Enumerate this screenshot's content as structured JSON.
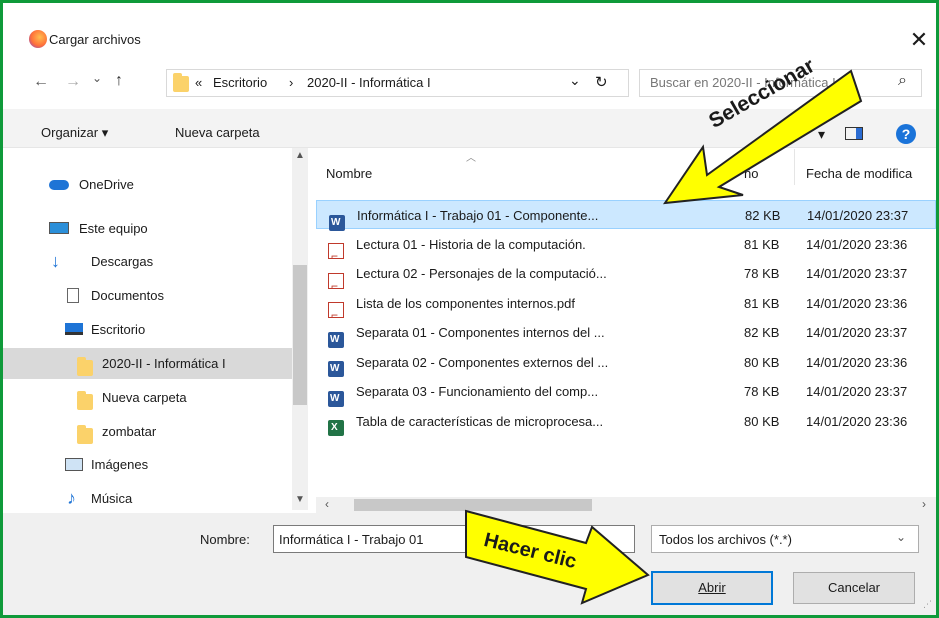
{
  "window": {
    "title": "Cargar archivos",
    "close": "✕"
  },
  "nav": {
    "back": "←",
    "forward": "→",
    "recent": "⌄",
    "up": "↑"
  },
  "address": {
    "overflow": "«",
    "crumb1": "Escritorio",
    "sep": "›",
    "crumb2": "2020-II - Informática I",
    "dropdown": "⌄",
    "refresh": "↻"
  },
  "search": {
    "placeholder": "Buscar en 2020-II - Informática I",
    "icon": "⌕"
  },
  "toolbar": {
    "organize": "Organizar ▾",
    "new_folder": "Nueva carpeta"
  },
  "sidebar": {
    "items": [
      {
        "label": "OneDrive"
      },
      {
        "label": "Este equipo"
      },
      {
        "label": "Descargas"
      },
      {
        "label": "Documentos"
      },
      {
        "label": "Escritorio"
      },
      {
        "label": "2020-II - Informática I"
      },
      {
        "label": "Nueva carpeta"
      },
      {
        "label": "zombatar"
      },
      {
        "label": "Imágenes"
      },
      {
        "label": "Música"
      }
    ]
  },
  "columns": {
    "name": "Nombre",
    "size": "ño",
    "date": "Fecha de modifica"
  },
  "files": [
    {
      "name": "Informática I - Trabajo 01 - Componente...",
      "size": "82 KB",
      "date": "14/01/2020 23:37",
      "type": "word"
    },
    {
      "name": "Lectura 01 - Historia de la computación.",
      "size": "81 KB",
      "date": "14/01/2020 23:36",
      "type": "pdf"
    },
    {
      "name": "Lectura 02 - Personajes de la computació...",
      "size": "78 KB",
      "date": "14/01/2020 23:37",
      "type": "pdf"
    },
    {
      "name": "Lista de los componentes internos.pdf",
      "size": "81 KB",
      "date": "14/01/2020 23:36",
      "type": "pdf"
    },
    {
      "name": "Separata 01 - Componentes internos del ...",
      "size": "82 KB",
      "date": "14/01/2020 23:37",
      "type": "word"
    },
    {
      "name": "Separata 02 - Componentes externos del ...",
      "size": "80 KB",
      "date": "14/01/2020 23:36",
      "type": "word"
    },
    {
      "name": "Separata 03 - Funcionamiento del comp...",
      "size": "78 KB",
      "date": "14/01/2020 23:37",
      "type": "word"
    },
    {
      "name": "Tabla de características de microprocesa...",
      "size": "80 KB",
      "date": "14/01/2020 23:36",
      "type": "excel"
    }
  ],
  "bottom": {
    "filename_label": "Nombre:",
    "filename_value": "Informática I - Trabajo 01",
    "filetype": "Todos los archivos (*.*)",
    "open": "Abrir",
    "cancel": "Cancelar"
  },
  "annotations": {
    "select": "Seleccionar",
    "click": "Hacer clic"
  },
  "colors": {
    "border": "#0f9a3a",
    "callout": "#ffff00",
    "selection": "#cce8ff"
  }
}
